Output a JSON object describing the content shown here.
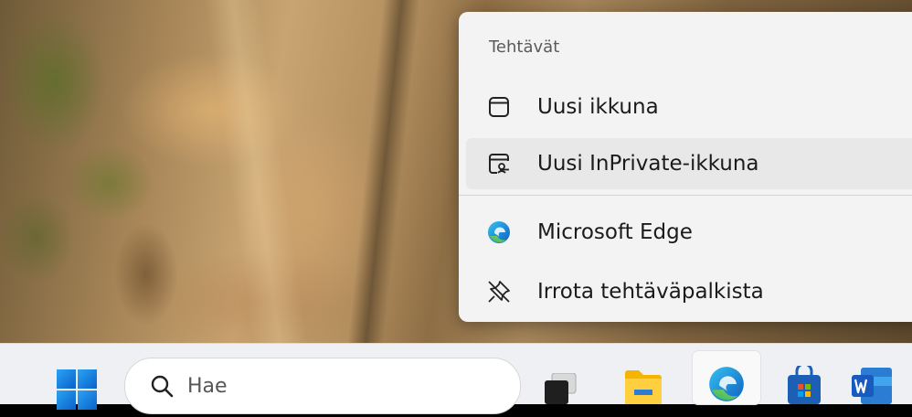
{
  "jumplist": {
    "header": "Tehtävät",
    "items": [
      {
        "label": "Uusi ikkuna",
        "icon": "window-icon"
      },
      {
        "label": "Uusi InPrivate-ikkuna",
        "icon": "inprivate-window-icon"
      },
      {
        "label": "Microsoft Edge",
        "icon": "edge-icon"
      },
      {
        "label": "Irrota tehtäväpalkista",
        "icon": "unpin-icon"
      }
    ]
  },
  "taskbar": {
    "search_placeholder": "Hae",
    "apps": [
      "task-view-icon",
      "file-explorer-icon",
      "edge-icon",
      "microsoft-store-icon",
      "word-icon"
    ]
  },
  "colors": {
    "accent": "#0078d4",
    "menu_bg": "#f3f3f3",
    "taskbar_bg": "#eef0f3"
  }
}
